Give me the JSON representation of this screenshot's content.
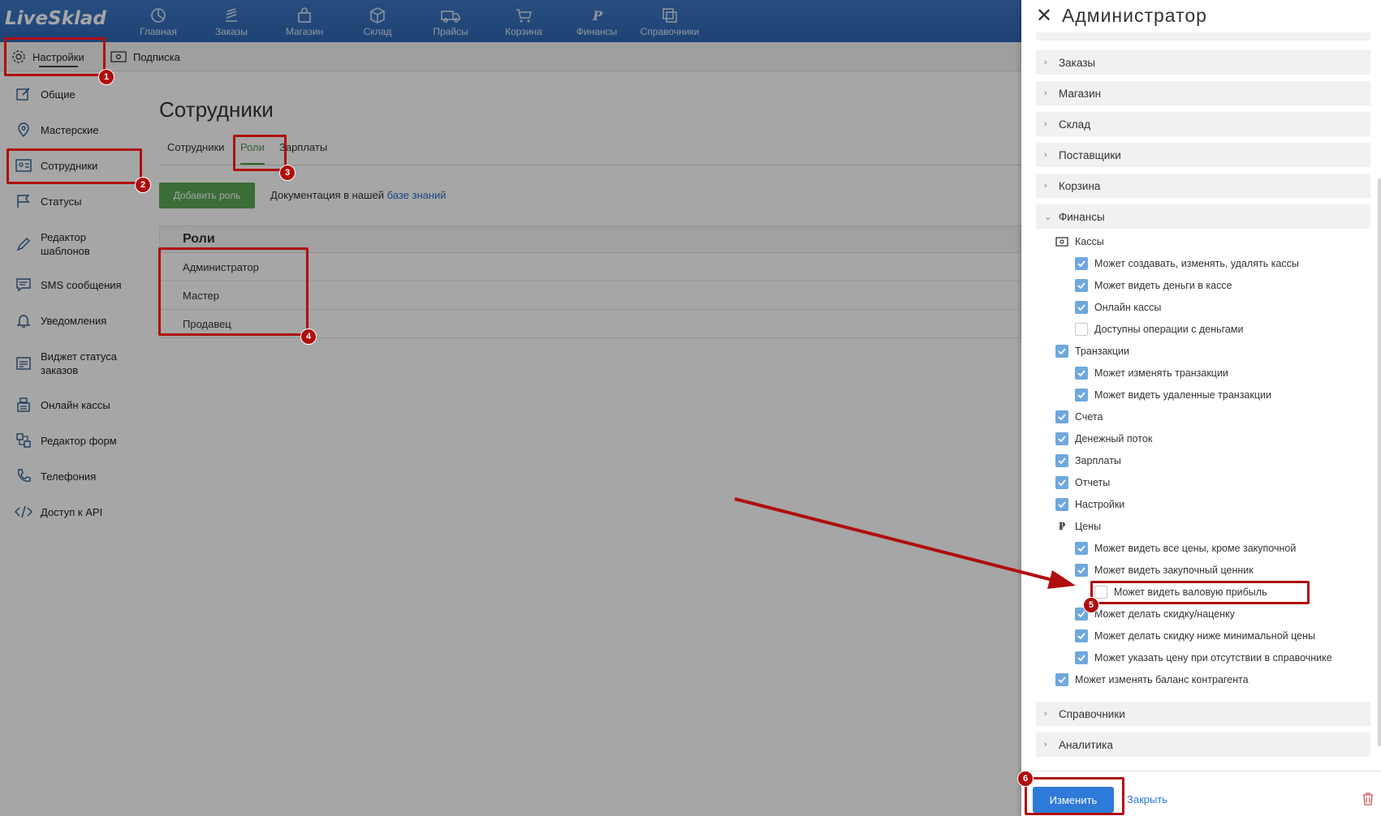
{
  "app": {
    "logo": "LiveSklad",
    "nav": [
      {
        "label": "Главная",
        "icon": "dashboard-icon"
      },
      {
        "label": "Заказы",
        "icon": "orders-icon"
      },
      {
        "label": "Магазин",
        "icon": "shop-bag-icon"
      },
      {
        "label": "Склад",
        "icon": "box-icon"
      },
      {
        "label": "Прайсы",
        "icon": "truck-icon"
      },
      {
        "label": "Корзина",
        "icon": "cart-icon"
      },
      {
        "label": "Финансы",
        "icon": "ruble-icon"
      },
      {
        "label": "Справочники",
        "icon": "copy-icon"
      }
    ]
  },
  "subbar": {
    "settings": "Настройки",
    "subscription": "Подписка"
  },
  "sidebar": {
    "items": [
      {
        "label": "Общие",
        "icon": "edit-icon"
      },
      {
        "label": "Мастерские",
        "icon": "location-pin-icon"
      },
      {
        "label": "Сотрудники",
        "icon": "id-card-icon"
      },
      {
        "label": "Статусы",
        "icon": "flag-icon"
      },
      {
        "label": "Редактор шаблонов",
        "icon": "pencil-icon"
      },
      {
        "label": "SMS сообщения",
        "icon": "message-icon"
      },
      {
        "label": "Уведомления",
        "icon": "bell-icon"
      },
      {
        "label": "Виджет статуса заказов",
        "icon": "widget-icon"
      },
      {
        "label": "Онлайн кассы",
        "icon": "cash-register-icon"
      },
      {
        "label": "Редактор форм",
        "icon": "form-icon"
      },
      {
        "label": "Телефония",
        "icon": "phone-icon"
      },
      {
        "label": "Доступ к API",
        "icon": "code-icon"
      }
    ]
  },
  "main": {
    "title": "Сотрудники",
    "tabs": [
      "Сотрудники",
      "Роли",
      "Зарплаты"
    ],
    "add_role": "Добавить роль",
    "doc_prefix": "Документация в нашей",
    "doc_link": "базе знаний",
    "roles_header": "Роли",
    "roles": [
      "Администратор",
      "Мастер",
      "Продавец"
    ]
  },
  "panel": {
    "title": "Администратор",
    "sections_top": [
      "Заказы",
      "Магазин",
      "Склад",
      "Поставщики",
      "Корзина"
    ],
    "finance_section": "Финансы",
    "perms": {
      "kassy": "Кассы",
      "kassy_1": "Может создавать, изменять, удалять кассы",
      "kassy_2": "Может видеть деньги в кассе",
      "kassy_3": "Онлайн кассы",
      "kassy_4": "Доступны операции с деньгами",
      "trans": "Транзакции",
      "trans_1": "Может изменять транзакции",
      "trans_2": "Может видеть удаленные транзакции",
      "accounts": "Счета",
      "cashflow": "Денежный поток",
      "salaries": "Зарплаты",
      "reports": "Отчеты",
      "settings": "Настройки",
      "prices": "Цены",
      "prices_1": "Может видеть все цены, кроме закупочной",
      "prices_2": "Может видеть закупочный ценник",
      "prices_3": "Может видеть валовую прибыль",
      "prices_4": "Может делать скидку/наценку",
      "prices_5": "Может делать скидку ниже минимальной цены",
      "prices_6": "Может указать цену при отсутствии в справочнике",
      "balance": "Может изменять баланс контрагента"
    },
    "sections_bottom": [
      "Справочники",
      "Аналитика"
    ],
    "save": "Изменить",
    "close": "Закрыть"
  },
  "annotations": [
    "1",
    "2",
    "3",
    "4",
    "5",
    "6"
  ],
  "colors": {
    "annotation": "#b00d0d",
    "topbar": "#2e68b5",
    "accent_green": "#4c9a48",
    "checkbox_on": "#6fa8de",
    "primary_button": "#2e7ad8"
  }
}
